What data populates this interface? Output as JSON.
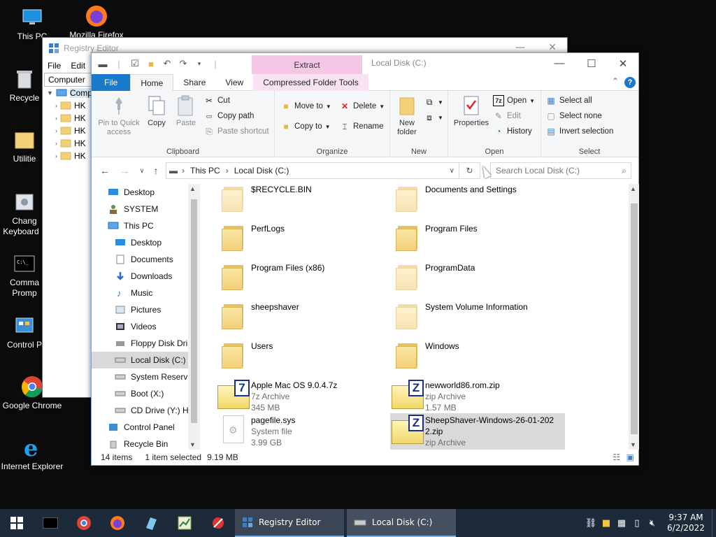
{
  "desktop": {
    "icons": [
      {
        "label": "This PC",
        "icon": "pc-icon"
      },
      {
        "label": "Mozilla Firefox",
        "icon": "firefox-icon"
      },
      {
        "label": "Recycle",
        "icon": "recycle-bin-icon"
      },
      {
        "label": "Utilitie",
        "icon": "folder-icon"
      },
      {
        "label": "Chang Keyboard L",
        "icon": "keyboard-icon"
      },
      {
        "label": "Comma Promp",
        "icon": "cmd-icon"
      },
      {
        "label": "Control P",
        "icon": "control-panel-icon"
      },
      {
        "label": "Google Chrome",
        "icon": "chrome-icon"
      },
      {
        "label": "Internet Explorer",
        "icon": "ie-icon"
      }
    ]
  },
  "registry": {
    "title": "Registry Editor",
    "menu": [
      "File",
      "Edit"
    ],
    "address": "Computer",
    "tree": [
      {
        "label": "Comp"
      },
      {
        "label": "HK"
      },
      {
        "label": "HK"
      },
      {
        "label": "HK"
      },
      {
        "label": "HK"
      },
      {
        "label": "HK"
      }
    ]
  },
  "explorer": {
    "title": "Local Disk (C:)",
    "context_tab": "Extract",
    "tabs": {
      "file": "File",
      "home": "Home",
      "share": "Share",
      "view": "View",
      "ctx": "Compressed Folder Tools"
    },
    "ribbon": {
      "clipboard": {
        "label": "Clipboard",
        "pin": "Pin to Quick access",
        "copy": "Copy",
        "paste": "Paste",
        "cut": "Cut",
        "copy_path": "Copy path",
        "paste_shortcut": "Paste shortcut"
      },
      "organize": {
        "label": "Organize",
        "move_to": "Move to",
        "copy_to": "Copy to",
        "delete": "Delete",
        "rename": "Rename"
      },
      "new": {
        "label": "New",
        "new_folder": "New folder"
      },
      "open": {
        "label": "Open",
        "properties": "Properties",
        "open": "Open",
        "edit": "Edit",
        "history": "History"
      },
      "select": {
        "label": "Select",
        "select_all": "Select all",
        "select_none": "Select none",
        "invert": "Invert selection"
      }
    },
    "address": {
      "crumbs": [
        "This PC",
        "Local Disk (C:)"
      ]
    },
    "search_placeholder": "Search Local Disk (C:)",
    "nav": [
      {
        "label": "Desktop",
        "indent": 1,
        "icon": "desktop-icon"
      },
      {
        "label": "SYSTEM",
        "indent": 1,
        "icon": "user-icon"
      },
      {
        "label": "This PC",
        "indent": 1,
        "icon": "pc-icon"
      },
      {
        "label": "Desktop",
        "indent": 2,
        "icon": "desktop-icon"
      },
      {
        "label": "Documents",
        "indent": 2,
        "icon": "documents-icon"
      },
      {
        "label": "Downloads",
        "indent": 2,
        "icon": "downloads-icon"
      },
      {
        "label": "Music",
        "indent": 2,
        "icon": "music-icon"
      },
      {
        "label": "Pictures",
        "indent": 2,
        "icon": "pictures-icon"
      },
      {
        "label": "Videos",
        "indent": 2,
        "icon": "videos-icon"
      },
      {
        "label": "Floppy Disk Dri",
        "indent": 2,
        "icon": "floppy-icon"
      },
      {
        "label": "Local Disk (C:)",
        "indent": 2,
        "icon": "drive-icon",
        "selected": true
      },
      {
        "label": "System Reserve",
        "indent": 2,
        "icon": "drive-icon"
      },
      {
        "label": "Boot (X:)",
        "indent": 2,
        "icon": "drive-icon"
      },
      {
        "label": "CD Drive (Y:) H",
        "indent": 2,
        "icon": "cd-icon"
      },
      {
        "label": "Control Panel",
        "indent": 1,
        "icon": "control-panel-icon"
      },
      {
        "label": "Recycle Bin",
        "indent": 1,
        "icon": "recycle-bin-icon"
      }
    ],
    "files": [
      {
        "name": "$RECYCLE.BIN",
        "type": "",
        "size": "",
        "kind": "folder-faded"
      },
      {
        "name": "Documents and Settings",
        "type": "",
        "size": "",
        "kind": "folder-faded"
      },
      {
        "name": "PerfLogs",
        "type": "",
        "size": "",
        "kind": "folder"
      },
      {
        "name": "Program Files",
        "type": "",
        "size": "",
        "kind": "folder"
      },
      {
        "name": "Program Files (x86)",
        "type": "",
        "size": "",
        "kind": "folder"
      },
      {
        "name": "ProgramData",
        "type": "",
        "size": "",
        "kind": "folder-faded"
      },
      {
        "name": "sheepshaver",
        "type": "",
        "size": "",
        "kind": "folder"
      },
      {
        "name": "System Volume Information",
        "type": "",
        "size": "",
        "kind": "folder-faded"
      },
      {
        "name": "Users",
        "type": "",
        "size": "",
        "kind": "folder"
      },
      {
        "name": "Windows",
        "type": "",
        "size": "",
        "kind": "folder"
      },
      {
        "name": "Apple Mac OS 9.0.4.7z",
        "type": "7z Archive",
        "size": "345 MB",
        "kind": "7z"
      },
      {
        "name": "newworld86.rom.zip",
        "type": "zip Archive",
        "size": "1.57 MB",
        "kind": "zip"
      },
      {
        "name": "pagefile.sys",
        "type": "System file",
        "size": "3.99 GB",
        "kind": "sys"
      },
      {
        "name": "SheepShaver-Windows-26-01-2022.zip",
        "type": "zip Archive",
        "size": "",
        "kind": "zip",
        "selected": true
      }
    ],
    "status": {
      "count": "14 items",
      "selected": "1 item selected",
      "size": "9.19 MB"
    }
  },
  "taskbar": {
    "apps": [
      {
        "label": "Registry Editor",
        "icon": "registry-icon"
      },
      {
        "label": "Local Disk (C:)",
        "icon": "drive-icon"
      }
    ],
    "time": "9:37 AM",
    "date": "6/2/2022"
  }
}
